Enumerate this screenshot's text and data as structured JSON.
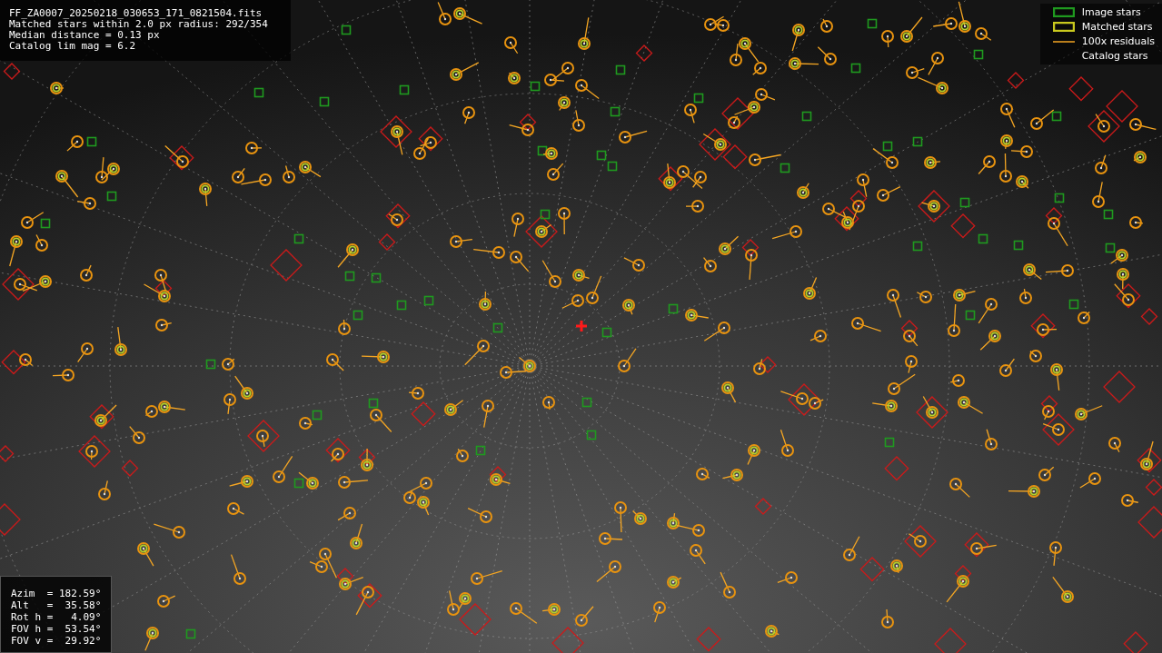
{
  "file_info": {
    "lines": [
      "FF_ZA0007_20250218_030653_171_0821504.fits",
      "Matched stars within 2.0 px radius: 292/354",
      "Median distance = 0.13 px",
      "Catalog lim mag = 6.2"
    ]
  },
  "legend": [
    {
      "label": "Image stars",
      "kind": "image"
    },
    {
      "label": "Matched stars",
      "kind": "matched"
    },
    {
      "label": "100x residuals",
      "kind": "residual"
    },
    {
      "label": "Catalog stars",
      "kind": "catalog"
    }
  ],
  "pointing": {
    "lines": [
      "Azim  = 182.59°",
      "Alt   =  35.58°",
      "Rot h =   4.09°",
      "FOV h =  53.54°",
      "FOV v =  29.92°"
    ]
  }
}
